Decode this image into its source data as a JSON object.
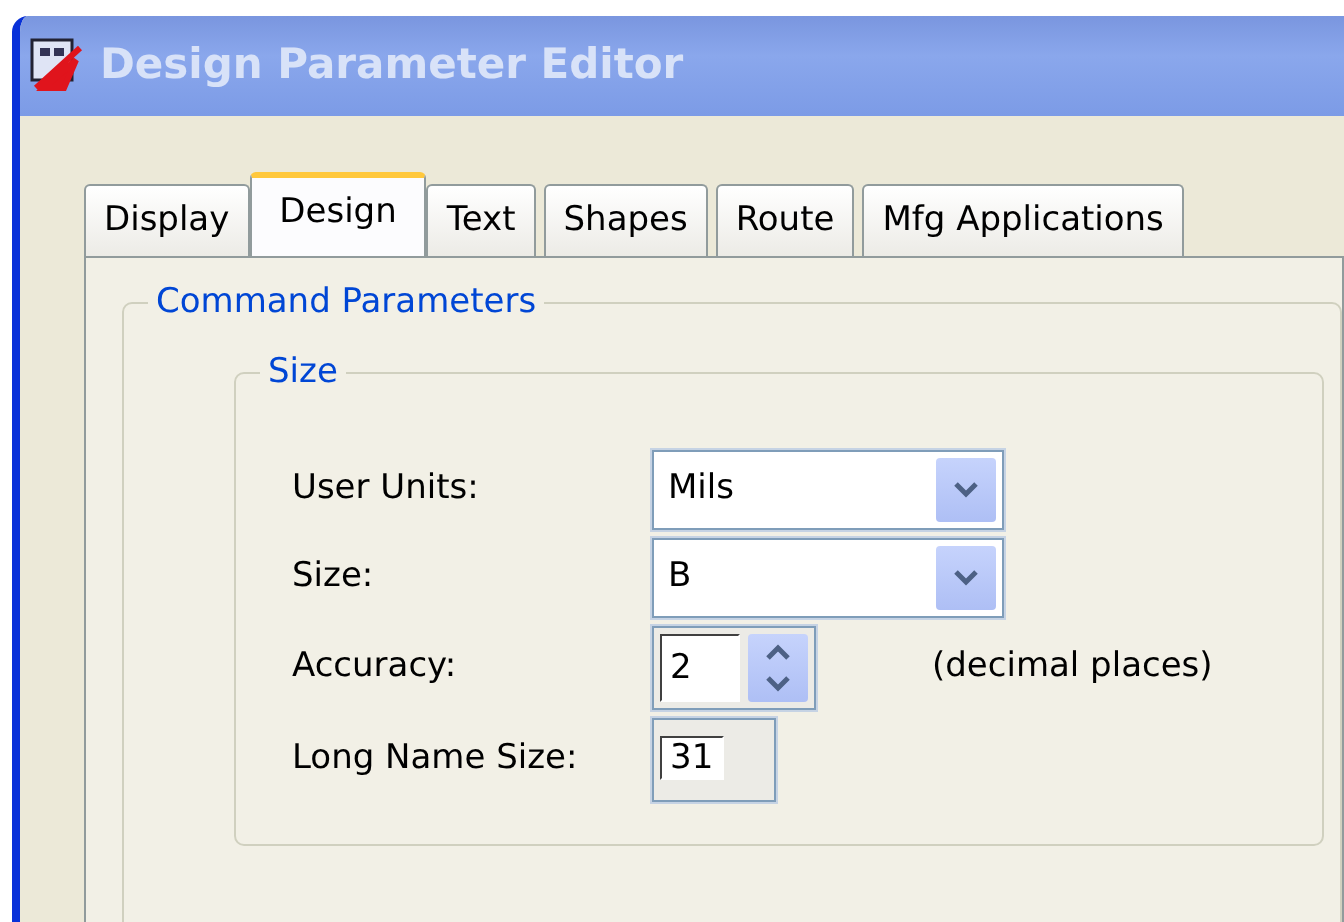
{
  "window": {
    "title": "Design Parameter Editor"
  },
  "tabs": [
    {
      "label": "Display",
      "selected": false
    },
    {
      "label": "Design",
      "selected": true
    },
    {
      "label": "Text",
      "selected": false
    },
    {
      "label": "Shapes",
      "selected": false
    },
    {
      "label": "Route",
      "selected": false
    },
    {
      "label": "Mfg Applications",
      "selected": false
    }
  ],
  "group": {
    "title": "Command Parameters",
    "subgroup": {
      "title": "Size",
      "fields": [
        {
          "kind": "dropdown",
          "label": "User Units:",
          "value": "Mils"
        },
        {
          "kind": "dropdown",
          "label": "Size:",
          "value": "B"
        },
        {
          "kind": "spinner",
          "label": "Accuracy:",
          "value": "2",
          "suffix": "(decimal places)"
        },
        {
          "kind": "textbox",
          "label": "Long Name Size:",
          "value": "31"
        }
      ]
    }
  }
}
